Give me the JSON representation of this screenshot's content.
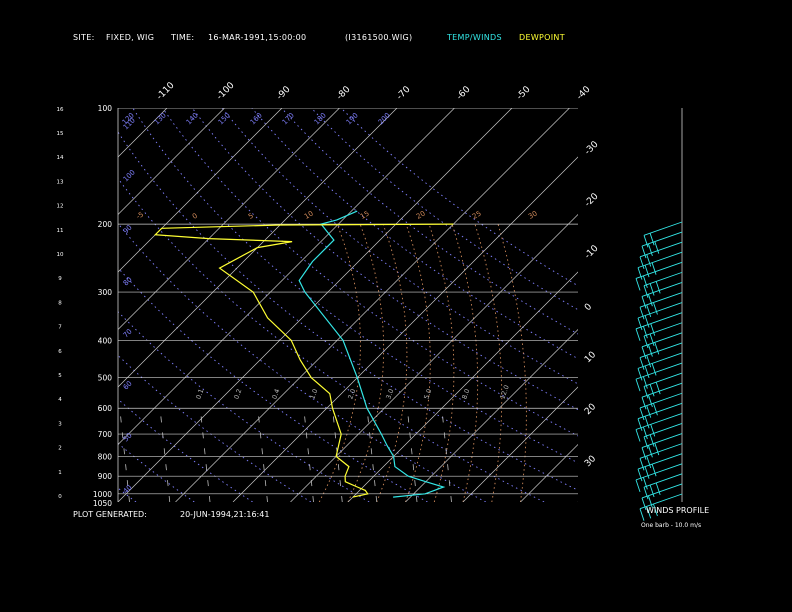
{
  "header": {
    "site_label": "SITE:",
    "site_value": "FIXED, WIG",
    "time_label": "TIME:",
    "time_value": "16-MAR-1991,15:00:00",
    "file_id": "(I3161500.WIG)",
    "legend_temp_winds": "TEMP/WINDS",
    "legend_dewpoint": "DEWPOINT"
  },
  "footer": {
    "plot_generated_label": "PLOT GENERATED:",
    "plot_generated_value": "20-JUN-1994,21:16:41",
    "winds_profile_label": "WINDS PROFILE",
    "barb_note": "One barb - 10.0 m/s"
  },
  "colors": {
    "temperature": "#33e6e6",
    "dewpoint": "#ffff33",
    "isotherm": "#c8c8c8",
    "isobar": "#d0d0d0",
    "dry_adiabat": "#8080ff",
    "moist_adiabat": "#d08a5a",
    "mixing_ratio": "#bbbbbb",
    "legend_temp": "#33e6e6",
    "legend_dew": "#ffff33"
  },
  "chart_data": {
    "type": "line",
    "diagram": "skew-T log-P",
    "pressure_ticks": [
      "100",
      "200",
      "300",
      "400",
      "500",
      "600",
      "700",
      "800",
      "900",
      "1000",
      "1050"
    ],
    "height_ticks": [
      "0",
      "1",
      "2",
      "3",
      "4",
      "5",
      "6",
      "7",
      "8",
      "9",
      "10",
      "11",
      "12",
      "13",
      "14",
      "15",
      "16"
    ],
    "isotherm_top_labels": [
      "-110",
      "-100",
      "-90",
      "-80",
      "-70",
      "-60",
      "-50",
      "-40"
    ],
    "isotherm_right_labels": [
      "-30",
      "-20",
      "-10",
      "0",
      "10",
      "20",
      "30"
    ],
    "dry_adiabat_labels": [
      "40",
      "50",
      "60",
      "70",
      "80",
      "90",
      "100",
      "110",
      "120",
      "130",
      "140",
      "150",
      "160",
      "170",
      "180",
      "190",
      "200"
    ],
    "moist_adiabat_labels": [
      "-5",
      "0",
      "5",
      "10",
      "15",
      "20",
      "25",
      "30"
    ],
    "mixing_ratio_labels": [
      "0.1",
      "0.2",
      "0.4",
      "1.0",
      "2.0",
      "3.0",
      "5.0",
      "8.0",
      "12.0"
    ],
    "xlim_temp_at_1050": [
      -40,
      40
    ],
    "ylim_pressure": [
      1050,
      100
    ],
    "series": [
      {
        "role": "temperature",
        "points": [
          [
            1020,
            7
          ],
          [
            1000,
            12
          ],
          [
            980,
            13
          ],
          [
            960,
            14
          ],
          [
            930,
            10
          ],
          [
            900,
            6
          ],
          [
            850,
            2
          ],
          [
            800,
            0
          ],
          [
            750,
            -3
          ],
          [
            700,
            -6
          ],
          [
            600,
            -13
          ],
          [
            500,
            -20
          ],
          [
            400,
            -29
          ],
          [
            300,
            -44
          ],
          [
            280,
            -47
          ],
          [
            250,
            -48
          ],
          [
            220,
            -48
          ],
          [
            200,
            -53
          ],
          [
            195,
            -51
          ],
          [
            190,
            -50
          ],
          [
            185,
            -49
          ]
        ]
      },
      {
        "role": "dewpoint",
        "points": [
          [
            1020,
            0
          ],
          [
            1000,
            2
          ],
          [
            980,
            1
          ],
          [
            960,
            -1
          ],
          [
            930,
            -4
          ],
          [
            900,
            -5
          ],
          [
            850,
            -6
          ],
          [
            800,
            -10
          ],
          [
            700,
            -13
          ],
          [
            600,
            -19
          ],
          [
            550,
            -22
          ],
          [
            500,
            -28
          ],
          [
            450,
            -33
          ],
          [
            400,
            -38
          ],
          [
            350,
            -46
          ],
          [
            300,
            -53
          ],
          [
            260,
            -63
          ],
          [
            230,
            -60
          ],
          [
            222,
            -55
          ],
          [
            218,
            -70
          ],
          [
            213,
            -80
          ],
          [
            205,
            -80
          ],
          [
            201,
            -60
          ],
          [
            200,
            -30
          ]
        ]
      }
    ],
    "winds_profile": {
      "barbs": 28,
      "speed_per_barb_ms": 10.0
    }
  }
}
